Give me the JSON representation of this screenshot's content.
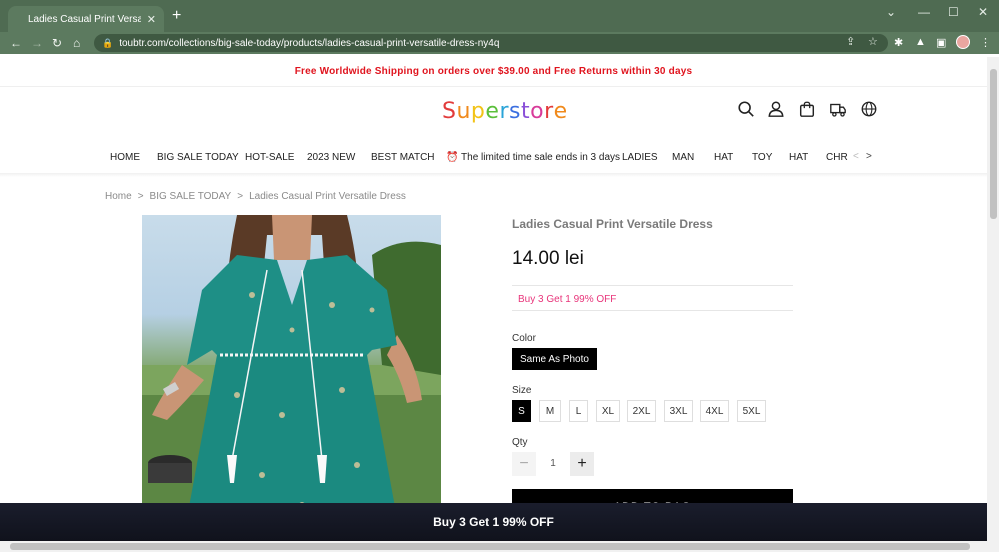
{
  "browser": {
    "tab_title": "Ladies Casual Print Versatile Dre",
    "url": "toubtr.com/collections/big-sale-today/products/ladies-casual-print-versatile-dress-ny4q"
  },
  "site": {
    "announcement": "Free Worldwide Shipping on orders over $39.00 and Free Returns within 30 days",
    "logo_letters": [
      {
        "ch": "S",
        "color": "#e23b3b"
      },
      {
        "ch": "u",
        "color": "#f08a1c"
      },
      {
        "ch": "p",
        "color": "#f2c318"
      },
      {
        "ch": "e",
        "color": "#5bbf3a"
      },
      {
        "ch": "r",
        "color": "#2aa4d8"
      },
      {
        "ch": "s",
        "color": "#3b6fe0"
      },
      {
        "ch": "t",
        "color": "#8a4fd8"
      },
      {
        "ch": "o",
        "color": "#d83b9a"
      },
      {
        "ch": "r",
        "color": "#e23b3b"
      },
      {
        "ch": "e",
        "color": "#f08a1c"
      }
    ],
    "header_icons": [
      "search-icon",
      "user-icon",
      "bag-icon",
      "truck-icon",
      "globe-icon"
    ],
    "menu": [
      "HOME",
      "BIG SALE TODAY",
      "HOT-SALE",
      "2023 NEW",
      "BEST MATCH",
      "⏰ The limited time sale ends in 3 days",
      "LADIES",
      "MAN",
      "HAT",
      "TOY",
      "HAT",
      "CHR"
    ]
  },
  "breadcrumb": [
    "Home",
    "BIG SALE TODAY",
    "Ladies Casual Print Versatile Dress"
  ],
  "product": {
    "title": "Ladies Casual Print Versatile Dress",
    "price": "14.00 lei",
    "promo": "Buy 3 Get 1 99% OFF",
    "color_label": "Color",
    "color_value": "Same As Photo",
    "size_label": "Size",
    "sizes": [
      "S",
      "M",
      "L",
      "XL",
      "2XL",
      "3XL",
      "4XL",
      "5XL"
    ],
    "selected_size": "S",
    "qty_label": "Qty",
    "qty": "1",
    "add_to_bag": "ADD TO BAG"
  },
  "sticky_bar": "Buy 3 Get 1 99% OFF"
}
